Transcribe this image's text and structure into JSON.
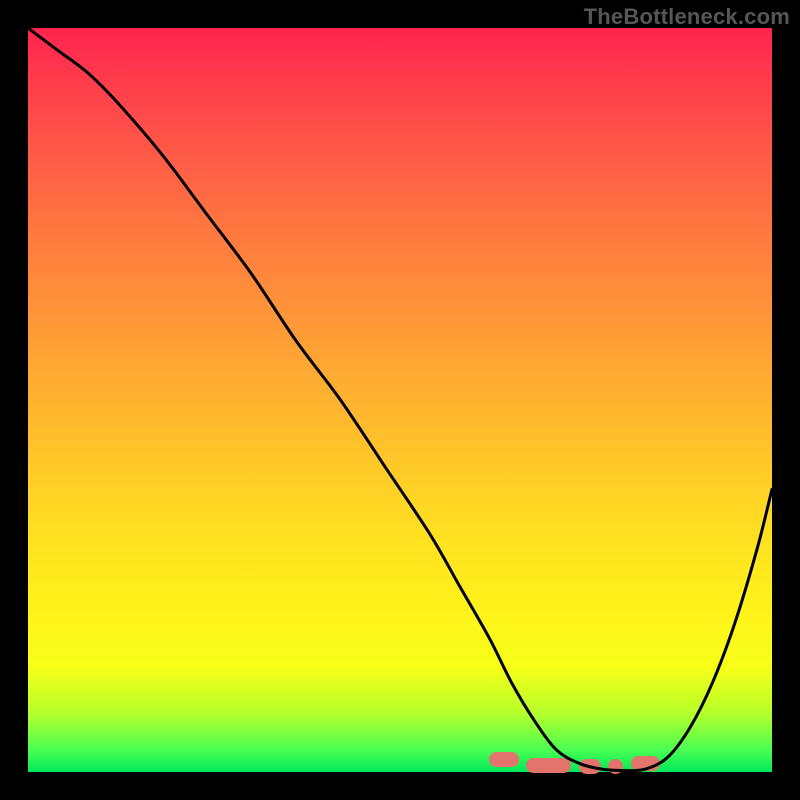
{
  "watermark": "TheBottleneck.com",
  "chart_data": {
    "type": "line",
    "title": "",
    "xlabel": "",
    "ylabel": "",
    "xlim": [
      0,
      100
    ],
    "ylim": [
      0,
      100
    ],
    "series": [
      {
        "name": "bottleneck-curve",
        "x": [
          0,
          4,
          8,
          12,
          18,
          24,
          30,
          36,
          42,
          48,
          54,
          58,
          62,
          65,
          68,
          71,
          74,
          77,
          80,
          83,
          86,
          89,
          92,
          95,
          98,
          100
        ],
        "y": [
          100,
          97,
          94,
          90,
          83,
          75,
          67,
          58,
          50,
          41,
          32,
          25,
          18,
          12,
          7,
          3,
          1.2,
          0.4,
          0.2,
          0.4,
          2,
          6,
          12,
          20,
          30,
          38
        ]
      }
    ],
    "markers": {
      "name": "optimal-range-dashes",
      "color": "#e2746c",
      "segments": [
        {
          "x": 62,
          "y": 1.8,
          "len": 4
        },
        {
          "x": 67,
          "y": 1.0,
          "len": 6
        },
        {
          "x": 74,
          "y": 0.8,
          "len": 3
        },
        {
          "x": 78,
          "y": 0.8,
          "len": 2
        },
        {
          "x": 81,
          "y": 1.2,
          "len": 4
        }
      ]
    },
    "gradient_colors": {
      "top": "#ff244e",
      "mid": "#ffc729",
      "bottom": "#00e85a"
    }
  }
}
